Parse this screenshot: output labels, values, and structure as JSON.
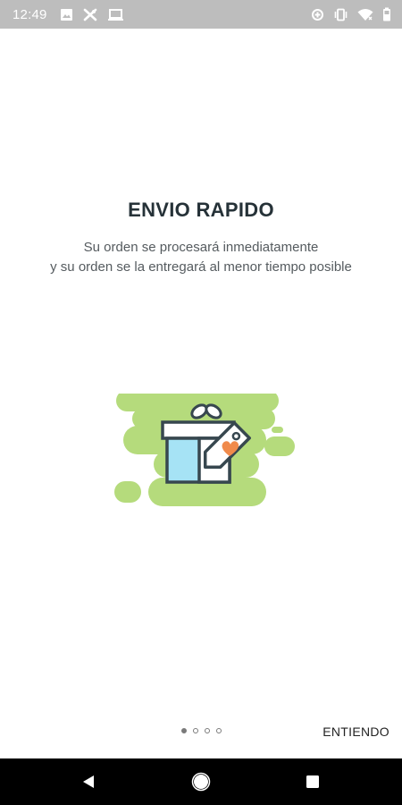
{
  "status_bar": {
    "time": "12:49",
    "left_icons": [
      "image-icon",
      "x-app-icon",
      "laptop-icon"
    ],
    "right_icons": [
      "data-saver-icon",
      "vibrate-icon",
      "wifi-icon",
      "battery-icon"
    ]
  },
  "onboarding": {
    "title": "ENVIO RAPIDO",
    "subtitle_line1": "Su orden se procesará inmediatamente",
    "subtitle_line2": "y su orden se la entregará al menor tiempo posible",
    "illustration": "gift-box-with-heart-tag",
    "pager": {
      "total": 4,
      "current": 1
    },
    "confirm_label": "ENTIENDO"
  },
  "colors": {
    "status_bar": "#bdbdbd",
    "title": "#263238",
    "subtitle": "#555b5f",
    "blob_green": "#b5db7c",
    "box_blue": "#a6e3f5",
    "heart_orange": "#f08a4b",
    "outline": "#37474f",
    "nav_bar": "#000000"
  },
  "nav_bar": {
    "buttons": [
      "back-icon",
      "home-icon",
      "recents-icon"
    ]
  }
}
